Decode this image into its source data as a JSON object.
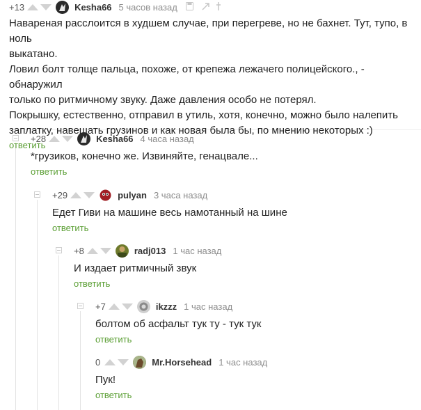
{
  "comments": [
    {
      "rating": "+13",
      "user": "Kesha66",
      "time": "5 часов назад",
      "lines": [
        "Навареная расслоится в худшем случае, при перегреве, но не бахнет. Тут, тупо, в ноль",
        "выкатано.",
        "Ловил болт толще пальца, похоже, от крепежа лежачего полицейского., - обнаружил",
        "только по ритмичному звуку. Даже давления особо не потерял.",
        "Покрышку, естественно, отправил в утиль, хотя, конечно, можно было налепить",
        "заплатку, навешать грузинов  и как новая была бы, по мнению некоторых :)"
      ],
      "reply": "ответить",
      "icons": [
        "save-icon",
        "link-icon",
        "more-icon"
      ],
      "avatar_color": "#2a2a2a"
    },
    {
      "rating": "+28",
      "user": "Kesha66",
      "time": "4 часа назад",
      "lines": [
        "*грузиков, конечно же. Извиняйте, генацвале..."
      ],
      "reply": "ответить",
      "avatar_color": "#2a2a2a"
    },
    {
      "rating": "+29",
      "user": "pulyan",
      "time": "3 часа назад",
      "lines": [
        "Едет Гиви на машине весь намотанный на шине"
      ],
      "reply": "ответить",
      "avatar_color": "#a01e24"
    },
    {
      "rating": "+8",
      "user": "radj013",
      "time": "1 час назад",
      "lines": [
        "И издает ритмичный звук"
      ],
      "reply": "ответить",
      "avatar_color": "#6e7a2c"
    },
    {
      "rating": "+7",
      "user": "ikzzz",
      "time": "1 час назад",
      "lines": [
        "болтом об асфальт тук ту - тук тук"
      ],
      "reply": "ответить",
      "avatar_color": "#9a9a9a"
    },
    {
      "rating": "0",
      "user": "Mr.Horsehead",
      "time": "1 час назад",
      "lines": [
        "Пук!"
      ],
      "reply": "ответить",
      "avatar_color": "#7a5a3a"
    }
  ],
  "colors": {
    "reply_link": "#5a9e33",
    "vote_arrow": "#d2d2d2",
    "thread_line": "#e3e3e3"
  }
}
